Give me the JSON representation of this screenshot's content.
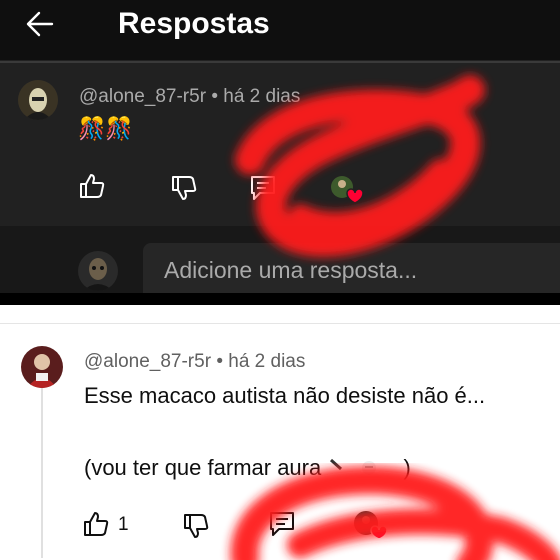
{
  "header": {
    "title": "Respostas",
    "back_icon": "arrow-left-icon"
  },
  "dark_comment": {
    "author": "@alone_87-r5r",
    "separator": "•",
    "time": "há 2 dias",
    "text": "🎊🎊",
    "actions": [
      "thumbs-up-icon",
      "thumbs-down-icon",
      "reply-icon",
      "creator-heart-icon"
    ]
  },
  "reply_box": {
    "placeholder": "Adicione uma resposta..."
  },
  "light_comment": {
    "author": "@alone_87-r5r",
    "separator": "•",
    "time": "há 2 dias",
    "line1": "Esse macaco autista não desiste não é...",
    "line2": "(vou ter que farmar aura",
    "like_count": "1",
    "actions": [
      "thumbs-up-icon",
      "thumbs-down-icon",
      "reply-icon",
      "creator-heart-icon"
    ]
  },
  "colors": {
    "dark_bg": "#212121",
    "light_bg": "#ffffff",
    "annotation": "#ff1a1a",
    "heart": "#ff0033"
  }
}
